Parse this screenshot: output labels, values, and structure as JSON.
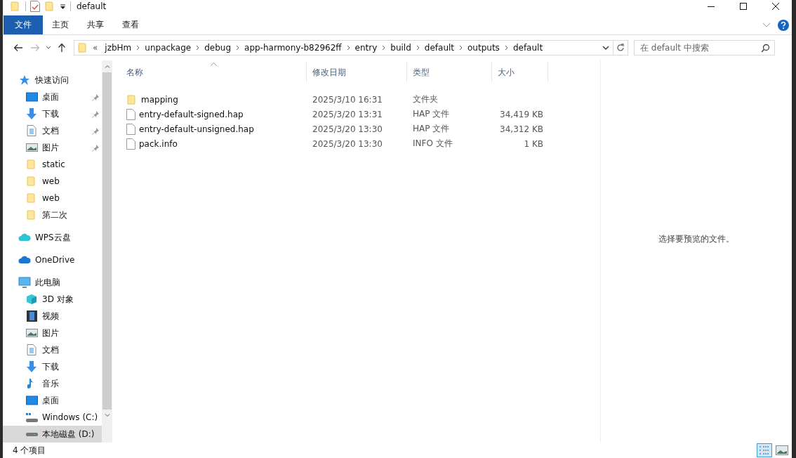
{
  "window": {
    "title": "default"
  },
  "ribbon": {
    "tabs": [
      {
        "label": "文件",
        "kind": "menu",
        "selected": false
      },
      {
        "label": "主页",
        "kind": "tab",
        "selected": false
      },
      {
        "label": "共享",
        "kind": "tab",
        "selected": false
      },
      {
        "label": "查看",
        "kind": "tab",
        "selected": false
      }
    ]
  },
  "address_bar": {
    "overflow": "«",
    "segments": [
      "jzbHm",
      "unpackage",
      "debug",
      "app-harmony-b82962ff",
      "entry",
      "build",
      "default",
      "outputs",
      "default"
    ]
  },
  "search": {
    "placeholder": "在 default 中搜索"
  },
  "sidebar": {
    "items": [
      {
        "label": "快速访问",
        "kind": "star",
        "selected": false,
        "children": [
          {
            "label": "桌面",
            "kind": "desktop",
            "pinned": true,
            "selected": false
          },
          {
            "label": "下载",
            "kind": "download",
            "pinned": true,
            "selected": false
          },
          {
            "label": "文档",
            "kind": "document",
            "pinned": true,
            "selected": false
          },
          {
            "label": "图片",
            "kind": "picture",
            "pinned": true,
            "selected": false
          },
          {
            "label": "static",
            "kind": "folder",
            "pinned": false,
            "selected": false
          },
          {
            "label": "web",
            "kind": "folder",
            "pinned": false,
            "selected": false
          },
          {
            "label": "web",
            "kind": "folder",
            "pinned": false,
            "selected": false
          },
          {
            "label": "第二次",
            "kind": "folder",
            "pinned": false,
            "selected": false
          }
        ]
      },
      {
        "label": "WPS云盘",
        "kind": "cloud",
        "selected": false
      },
      {
        "label": "OneDrive",
        "kind": "cloud2",
        "selected": false
      },
      {
        "label": "此电脑",
        "kind": "pc",
        "selected": false,
        "children": [
          {
            "label": "3D 对象",
            "kind": "cube",
            "selected": false
          },
          {
            "label": "视频",
            "kind": "video",
            "selected": false
          },
          {
            "label": "图片",
            "kind": "picture",
            "selected": false
          },
          {
            "label": "文档",
            "kind": "document",
            "selected": false
          },
          {
            "label": "下载",
            "kind": "download",
            "selected": false
          },
          {
            "label": "音乐",
            "kind": "music",
            "selected": false
          },
          {
            "label": "桌面",
            "kind": "desktop",
            "selected": false
          },
          {
            "label": "Windows (C:)",
            "kind": "windrive",
            "selected": false
          },
          {
            "label": "本地磁盘 (D:)",
            "kind": "drive",
            "selected": true
          }
        ]
      }
    ]
  },
  "table": {
    "columns": [
      {
        "label": "名称",
        "sorted": true
      },
      {
        "label": "修改日期",
        "sorted": false
      },
      {
        "label": "类型",
        "sorted": false
      },
      {
        "label": "大小",
        "sorted": false
      }
    ],
    "rows": [
      {
        "kind": "folder",
        "name": "mapping",
        "modified": "2025/3/10 16:31",
        "type": "文件夹"
      },
      {
        "kind": "file",
        "name": "entry-default-signed.hap",
        "modified": "2025/3/20 13:31",
        "type": "HAP 文件",
        "size": "34,419 KB"
      },
      {
        "kind": "file",
        "name": "entry-default-unsigned.hap",
        "modified": "2025/3/20 13:30",
        "type": "HAP 文件",
        "size": "34,312 KB"
      },
      {
        "kind": "file",
        "name": "pack.info",
        "modified": "2025/3/20 13:30",
        "type": "INFO 文件",
        "size": "1 KB"
      }
    ]
  },
  "preview_pane": {
    "message": "选择要预览的文件。"
  },
  "status_bar": {
    "item_count": "4 个项目",
    "views": [
      {
        "kind": "details",
        "selected": true
      },
      {
        "kind": "thumbnails",
        "selected": false
      }
    ]
  }
}
